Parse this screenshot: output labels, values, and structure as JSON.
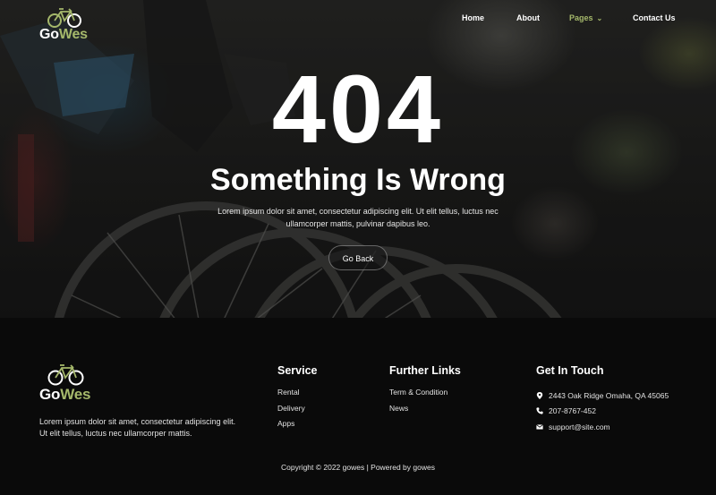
{
  "brand": {
    "part1": "Go",
    "part2": "Wes",
    "accent_color": "#a5b86b"
  },
  "nav": {
    "items": [
      {
        "label": "Home",
        "active": false
      },
      {
        "label": "About",
        "active": false
      },
      {
        "label": "Pages",
        "active": true,
        "has_dropdown": true
      },
      {
        "label": "Contact Us",
        "active": false
      }
    ]
  },
  "hero": {
    "code": "404",
    "headline": "Something Is Wrong",
    "description_line1": "Lorem ipsum dolor sit amet, consectetur adipiscing elit. Ut elit tellus, luctus nec",
    "description_line2": "ullamcorper mattis, pulvinar dapibus leo.",
    "button_label": "Go Back"
  },
  "footer": {
    "about_text": "Lorem ipsum dolor sit amet, consectetur adipiscing elit. Ut elit tellus, luctus nec ullamcorper mattis.",
    "service": {
      "title": "Service",
      "items": [
        "Rental",
        "Delivery",
        "Apps"
      ]
    },
    "further_links": {
      "title": "Further Links",
      "items": [
        "Term & Condition",
        "News"
      ]
    },
    "contact": {
      "title": "Get In Touch",
      "address": "2443 Oak Ridge Omaha, QA 45065",
      "phone": "207-8767-452",
      "email": "support@site.com"
    },
    "copyright": "Copyright © 2022 gowes | Powered by gowes"
  },
  "icons": {
    "logo": "bicycle-icon",
    "dropdown": "chevron-down-icon",
    "address": "map-pin-icon",
    "phone": "phone-icon",
    "email": "envelope-icon"
  }
}
